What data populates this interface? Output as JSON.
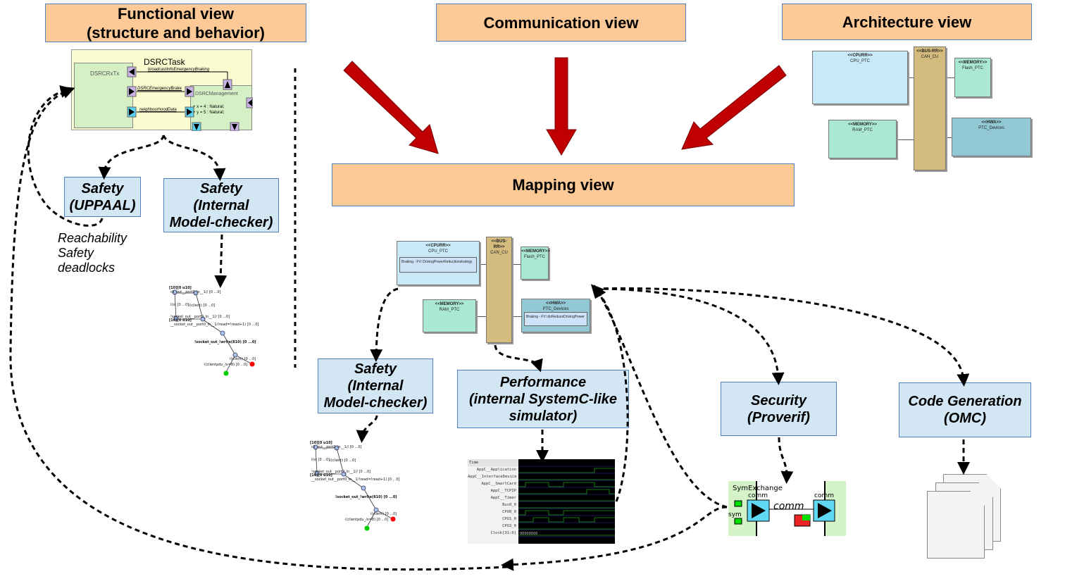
{
  "views": {
    "functional": "Functional view\n(structure and behavior)",
    "communication": "Communication view",
    "architecture": "Architecture view",
    "mapping": "Mapping view"
  },
  "tools": {
    "safety_uppaal": "Safety\n(UPPAAL)",
    "safety_internal_1": "Safety\n(Internal\nModel-checker)",
    "safety_internal_2": "Safety\n(Internal\nModel-checker)",
    "performance": "Performance\n(internal  SystemC-like\nsimulator)",
    "security": "Security\n(Proverif)",
    "codegen": "Code Generation\n(OMC)"
  },
  "properties": [
    "Reachability",
    "Safety",
    "deadlocks"
  ],
  "functional_diagram": {
    "task": "DSRCTask",
    "rxtx": "DSRCRxTx",
    "management": "DSRCManagement",
    "signals": [
      "broadcastInfoEmergencyBraking",
      "DSRCEmergencyBrake",
      "neighbourhoodData"
    ],
    "attributes": [
      "+ x = 4 : Natural;",
      "+ y = 5 : Natural;"
    ]
  },
  "architecture_diagram": {
    "cpu": {
      "stereo": "<<CPURR>>",
      "name": "CPU_PTC"
    },
    "bus": {
      "stereo": "<<BUS-RR>>",
      "name": "CAN_CU"
    },
    "flash": {
      "stereo": "<<MEMORY>>",
      "name": "Flash_PTC"
    },
    "ram": {
      "stereo": "<<MEMORY>>",
      "name": "RAM_PTC"
    },
    "hwa": {
      "stereo": "<<HWA>>",
      "name": "PTC_Devices"
    }
  },
  "mapping_diagram": {
    "cpu_task": "Braking - FV::DrivingPowerReductionstrategy",
    "hwa_task": "Braking - FV::doReduceDrivingPower"
  },
  "graph": {
    "labels": [
      "[10][0 u10]",
      "cli_out__port0_in__1// [0 ...0]",
      "i(st [0 ...0]",
      "i(client) [0 ...0]",
      "!socket_out__port0_in__1// [0 ...0]",
      "[10][0 u10]",
      "__socket_out__port0_in__1/!read=!read+1) [0 ...0]",
      "!socket_out_!write(810) [0 ...0]",
      "i(client) [0 ...0]",
      "i(clientpdu_/x=8) [0 ...0]"
    ]
  },
  "performance_trace": {
    "rows": [
      "Time",
      "AppC__Application",
      "AppC__InterfaceDevice",
      "AppC__SmartCard",
      "AppC__TCPIP",
      "AppC__Timer",
      "Bus0_0",
      "CPU0_0",
      "CPU1_0",
      "CPU2_0",
      "Clock[31:0]"
    ],
    "clock_value": "00000000"
  },
  "proverif": {
    "block": "SymExchange",
    "port_left": "comm",
    "port_right": "comm",
    "channel": "comm",
    "sym": "sym"
  },
  "colors": {
    "view": "#fdca97",
    "tool": "#d3e6f4",
    "arrow_red": "#c00000"
  }
}
